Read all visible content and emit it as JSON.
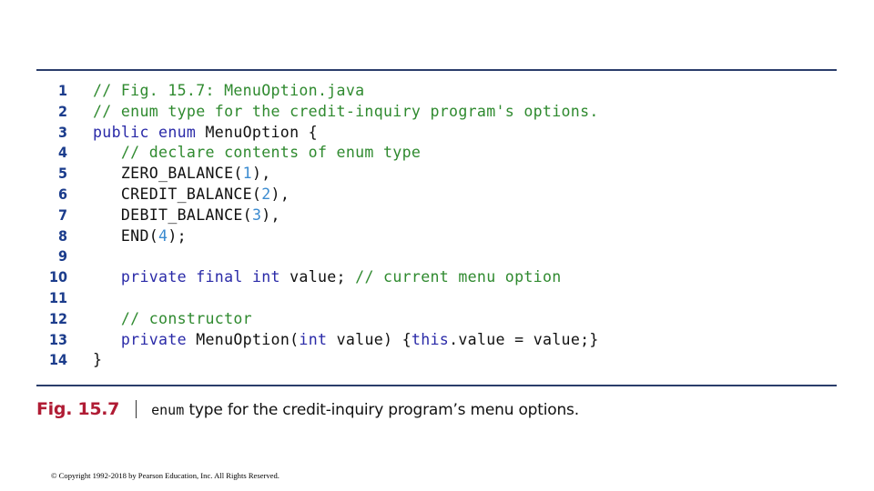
{
  "colors": {
    "rule": "#2a3d6b",
    "line_number": "#1b3c8c",
    "comment": "#2f8a2f",
    "keyword": "#2a2aa8",
    "number": "#3b8bd0",
    "plain": "#111111",
    "figure_label": "#b01c34"
  },
  "code": {
    "lines": [
      {
        "number": "1",
        "tokens": [
          {
            "t": "// Fig. 15.7: MenuOption.java",
            "k": "comment"
          }
        ]
      },
      {
        "number": "2",
        "tokens": [
          {
            "t": "// enum type for the credit-inquiry program's options.",
            "k": "comment"
          }
        ]
      },
      {
        "number": "3",
        "tokens": [
          {
            "t": "public enum ",
            "k": "keyword"
          },
          {
            "t": "MenuOption {",
            "k": "plain"
          }
        ]
      },
      {
        "number": "4",
        "tokens": [
          {
            "t": "   ",
            "k": "plain"
          },
          {
            "t": "// declare contents of enum type",
            "k": "comment"
          }
        ]
      },
      {
        "number": "5",
        "tokens": [
          {
            "t": "   ZERO_BALANCE(",
            "k": "plain"
          },
          {
            "t": "1",
            "k": "number"
          },
          {
            "t": "),",
            "k": "plain"
          }
        ]
      },
      {
        "number": "6",
        "tokens": [
          {
            "t": "   CREDIT_BALANCE(",
            "k": "plain"
          },
          {
            "t": "2",
            "k": "number"
          },
          {
            "t": "),",
            "k": "plain"
          }
        ]
      },
      {
        "number": "7",
        "tokens": [
          {
            "t": "   DEBIT_BALANCE(",
            "k": "plain"
          },
          {
            "t": "3",
            "k": "number"
          },
          {
            "t": "),",
            "k": "plain"
          }
        ]
      },
      {
        "number": "8",
        "tokens": [
          {
            "t": "   END(",
            "k": "plain"
          },
          {
            "t": "4",
            "k": "number"
          },
          {
            "t": ");",
            "k": "plain"
          }
        ]
      },
      {
        "number": "9",
        "tokens": []
      },
      {
        "number": "10",
        "tokens": [
          {
            "t": "   ",
            "k": "plain"
          },
          {
            "t": "private final int ",
            "k": "keyword"
          },
          {
            "t": "value; ",
            "k": "plain"
          },
          {
            "t": "// current menu option",
            "k": "comment"
          }
        ]
      },
      {
        "number": "11",
        "tokens": []
      },
      {
        "number": "12",
        "tokens": [
          {
            "t": "   ",
            "k": "plain"
          },
          {
            "t": "// constructor",
            "k": "comment"
          }
        ]
      },
      {
        "number": "13",
        "tokens": [
          {
            "t": "   ",
            "k": "plain"
          },
          {
            "t": "private ",
            "k": "keyword"
          },
          {
            "t": "MenuOption(",
            "k": "plain"
          },
          {
            "t": "int ",
            "k": "keyword"
          },
          {
            "t": "value) {",
            "k": "plain"
          },
          {
            "t": "this",
            "k": "keyword"
          },
          {
            "t": ".value = value;}",
            "k": "plain"
          }
        ]
      },
      {
        "number": "14",
        "tokens": [
          {
            "t": "}",
            "k": "plain"
          }
        ]
      }
    ]
  },
  "caption": {
    "label": "Fig. 15.7",
    "code_word": "enum",
    "text": " type for the credit-inquiry program’s menu options."
  },
  "footer": {
    "copyright": "© Copyright 1992-2018 by Pearson Education, Inc. All Rights Reserved."
  }
}
